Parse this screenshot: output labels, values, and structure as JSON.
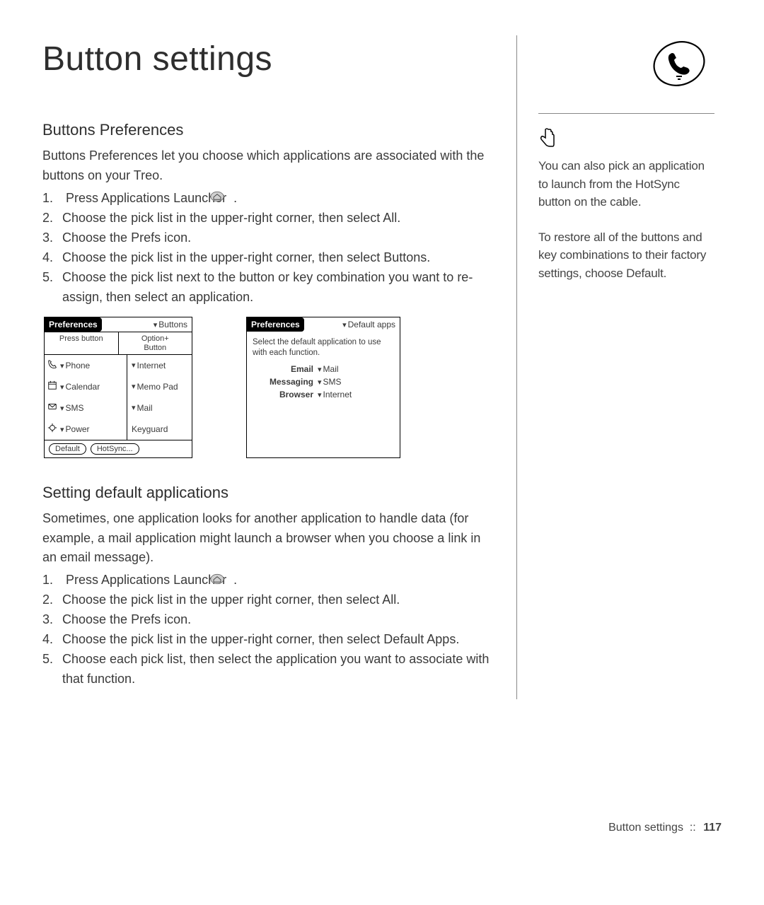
{
  "page_title": "Button settings",
  "section1": {
    "heading": "Buttons Preferences",
    "intro": "Buttons Preferences let you choose which applications are associated with the buttons on your Treo.",
    "steps": [
      "Press Applications Launcher",
      "Choose the pick list in the upper-right corner, then select All.",
      "Choose the Prefs icon.",
      "Choose the pick list in the upper-right corner, then select Buttons.",
      "Choose the pick list next to the button or key combination you want to re-assign, then select an application."
    ]
  },
  "screen_left": {
    "title": "Preferences",
    "picklist": "Buttons",
    "header_a": "Press button",
    "header_b": "Option+\nButton",
    "rows": [
      {
        "a": "Phone",
        "b": "Internet"
      },
      {
        "a": "Calendar",
        "b": "Memo Pad"
      },
      {
        "a": "SMS",
        "b": "Mail"
      },
      {
        "a": "Power",
        "b": "Keyguard"
      }
    ],
    "btn_default": "Default",
    "btn_hotsync": "HotSync..."
  },
  "screen_right": {
    "title": "Preferences",
    "picklist": "Default apps",
    "instruction": "Select the default application to use with each function.",
    "rows": [
      {
        "label": "Email",
        "val": "Mail"
      },
      {
        "label": "Messaging",
        "val": "SMS"
      },
      {
        "label": "Browser",
        "val": "Internet"
      }
    ]
  },
  "section2": {
    "heading": "Setting default applications",
    "intro": "Sometimes, one application looks for another application to handle data (for example, a mail application might launch a browser when you choose a link in an email message).",
    "steps": [
      "Press Applications Launcher",
      "Choose the pick list in the upper right corner, then select All.",
      "Choose the Prefs icon.",
      "Choose the pick list in the upper-right corner, then select Default Apps.",
      "Choose each pick list, then select the application you want to associate with that function."
    ]
  },
  "sidebar": {
    "tip1": "You can also pick an application to launch from the HotSync button on the cable.",
    "tip2": "To restore all of the buttons and key combinations to their factory settings, choose Default."
  },
  "footer": {
    "label": "Button settings",
    "sep": "::",
    "page": "117"
  }
}
